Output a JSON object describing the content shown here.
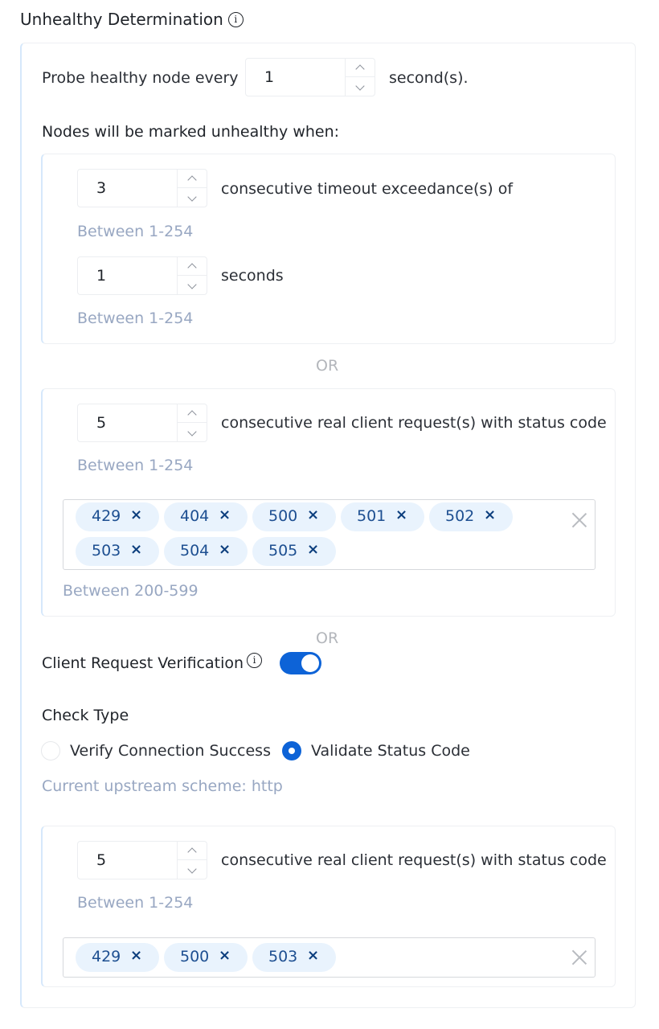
{
  "section": {
    "title": "Unhealthy Determination",
    "info_icon": "info-icon"
  },
  "probe": {
    "label_before": "Probe healthy node every",
    "value": "1",
    "label_after": "second(s)."
  },
  "unhealthy_heading": "Nodes will be marked unhealthy when:",
  "timeout_group": {
    "count_value": "3",
    "count_label": "consecutive timeout exceedance(s) of",
    "count_hint": "Between 1-254",
    "seconds_value": "1",
    "seconds_label": "seconds",
    "seconds_hint": "Between 1-254"
  },
  "or_label": "OR",
  "status_group": {
    "count_value": "5",
    "count_label": "consecutive real client request(s) with status code",
    "count_hint": "Between 1-254",
    "codes": [
      "429",
      "404",
      "500",
      "501",
      "502",
      "503",
      "504",
      "505"
    ],
    "codes_hint": "Between 200-599"
  },
  "client_verification": {
    "label": "Client Request Verification",
    "enabled": true,
    "check_type_label": "Check Type",
    "options": [
      {
        "label": "Verify Connection Success",
        "selected": false
      },
      {
        "label": "Validate Status Code",
        "selected": true
      }
    ],
    "scheme_note": "Current upstream scheme: http",
    "count_value": "5",
    "count_label": "consecutive real client request(s) with status code",
    "count_hint": "Between 1-254",
    "codes": [
      "429",
      "500",
      "503"
    ]
  },
  "colors": {
    "accent": "#0d63d7",
    "tag_bg": "#e9f3fd",
    "tag_text": "#1d4f91",
    "hint": "#98a7c2"
  }
}
